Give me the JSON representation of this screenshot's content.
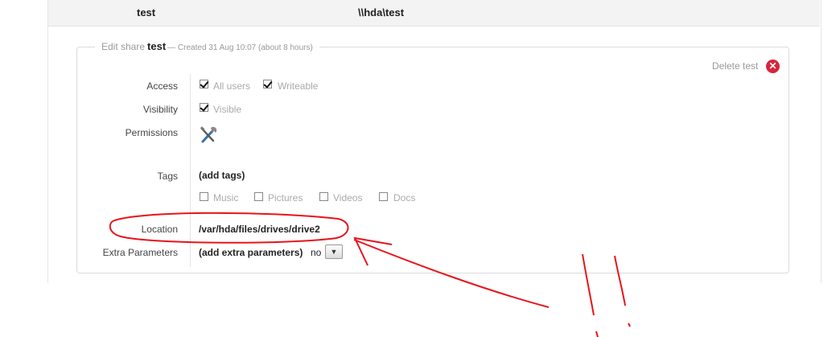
{
  "share_row": {
    "name": "test",
    "path": "\\\\hda\\test"
  },
  "edit_share": {
    "title_prefix": "Edit share",
    "name": "test",
    "meta": "— Created 31 Aug 10:07 (about 8 hours)",
    "delete_label": "Delete test"
  },
  "fields": {
    "access": {
      "label": "Access",
      "options": [
        {
          "label": "All users",
          "checked": true
        },
        {
          "label": "Writeable",
          "checked": true
        }
      ]
    },
    "visibility": {
      "label": "Visibility",
      "options": [
        {
          "label": "Visible",
          "checked": true
        }
      ]
    },
    "permissions": {
      "label": "Permissions",
      "icon": "tools-icon"
    },
    "tags": {
      "label": "Tags",
      "add_label": "(add tags)",
      "options": [
        {
          "label": "Music",
          "checked": false
        },
        {
          "label": "Pictures",
          "checked": false
        },
        {
          "label": "Videos",
          "checked": false
        },
        {
          "label": "Docs",
          "checked": false
        }
      ]
    },
    "location": {
      "label": "Location",
      "value": "/var/hda/files/drives/drive2"
    },
    "extra_parameters": {
      "label": "Extra Parameters",
      "add_label": "(add extra parameters)",
      "selected": "no"
    }
  },
  "colors": {
    "delete": "#d6263b",
    "annotation": "#e8141b"
  }
}
